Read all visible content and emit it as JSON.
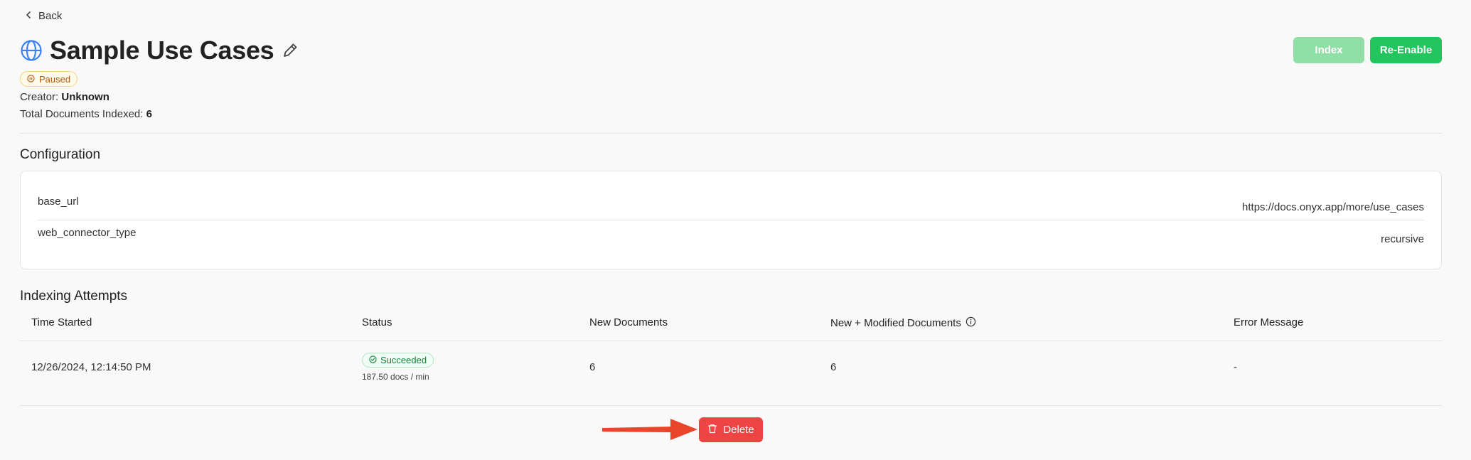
{
  "nav": {
    "back_label": "Back"
  },
  "header": {
    "title": "Sample Use Cases",
    "status": "Paused",
    "creator_label": "Creator:",
    "creator_value": "Unknown",
    "docs_label": "Total Documents Indexed:",
    "docs_value": "6",
    "index_button": "Index",
    "reenable_button": "Re-Enable"
  },
  "configuration": {
    "title": "Configuration",
    "rows": [
      {
        "key": "base_url",
        "value": "https://docs.onyx.app/more/use_cases"
      },
      {
        "key": "web_connector_type",
        "value": "recursive"
      }
    ]
  },
  "indexing": {
    "title": "Indexing Attempts",
    "columns": [
      "Time Started",
      "Status",
      "New Documents",
      "New + Modified Documents",
      "Error Message"
    ],
    "rows": [
      {
        "time_started": "12/26/2024, 12:14:50 PM",
        "status": "Succeeded",
        "rate": "187.50 docs / min",
        "new_documents": "6",
        "new_modified_documents": "6",
        "error_message": "-"
      }
    ]
  },
  "actions": {
    "delete_label": "Delete"
  },
  "colors": {
    "accent_green": "#22c55e",
    "accent_green_disabled": "#8fdfa6",
    "danger_red": "#ef4444",
    "annotation_arrow": "#e8452a",
    "globe_blue": "#3b82f6",
    "paused_amber": "#b45309",
    "succeeded_green": "#15803d"
  },
  "icons": {
    "back": "chevron-left-icon",
    "title": "globe-icon",
    "edit": "pencil-icon",
    "paused": "pause-circle-icon",
    "info": "info-circle-icon",
    "succeeded": "check-circle-icon",
    "delete": "trash-icon"
  }
}
